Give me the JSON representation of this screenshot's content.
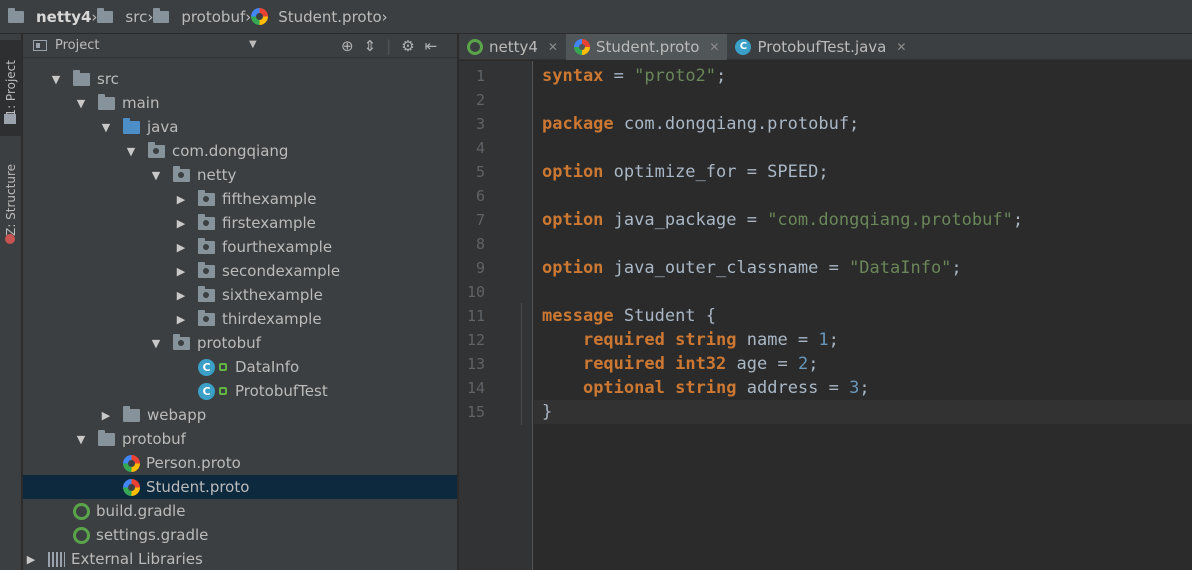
{
  "breadcrumb": {
    "items": [
      "netty4",
      "src",
      "protobuf",
      "Student.proto"
    ]
  },
  "tool_strip": {
    "project_tab": "1: Project",
    "structure_tab": "Z: Structure"
  },
  "project_panel": {
    "title": "Project",
    "tree": [
      {
        "label": "src",
        "kind": "folder",
        "expanded": true
      },
      {
        "label": "main",
        "kind": "folder",
        "expanded": true
      },
      {
        "label": "java",
        "kind": "source-folder",
        "expanded": true
      },
      {
        "label": "com.dongqiang",
        "kind": "package",
        "expanded": true
      },
      {
        "label": "netty",
        "kind": "package",
        "expanded": true
      },
      {
        "label": "fifthexample",
        "kind": "package",
        "expanded": false
      },
      {
        "label": "firstexample",
        "kind": "package",
        "expanded": false
      },
      {
        "label": "fourthexample",
        "kind": "package",
        "expanded": false
      },
      {
        "label": "secondexample",
        "kind": "package",
        "expanded": false
      },
      {
        "label": "sixthexample",
        "kind": "package",
        "expanded": false
      },
      {
        "label": "thirdexample",
        "kind": "package",
        "expanded": false
      },
      {
        "label": "protobuf",
        "kind": "package",
        "expanded": true
      },
      {
        "label": "DataInfo",
        "kind": "class"
      },
      {
        "label": "ProtobufTest",
        "kind": "class"
      },
      {
        "label": "webapp",
        "kind": "folder",
        "expanded": false
      },
      {
        "label": "protobuf",
        "kind": "folder",
        "expanded": true
      },
      {
        "label": "Person.proto",
        "kind": "proto"
      },
      {
        "label": "Student.proto",
        "kind": "proto",
        "selected": true
      },
      {
        "label": "build.gradle",
        "kind": "gradle"
      },
      {
        "label": "settings.gradle",
        "kind": "gradle"
      },
      {
        "label": "External Libraries",
        "kind": "libraries",
        "expanded": false
      }
    ]
  },
  "editor_tabs": [
    {
      "label": "netty4",
      "icon": "gradle-icon",
      "active": false
    },
    {
      "label": "Student.proto",
      "icon": "proto-icon",
      "active": true
    },
    {
      "label": "ProtobufTest.java",
      "icon": "class-icon",
      "active": false
    }
  ],
  "editor": {
    "line_numbers": [
      "1",
      "2",
      "3",
      "4",
      "5",
      "6",
      "7",
      "8",
      "9",
      "10",
      "11",
      "12",
      "13",
      "14",
      "15"
    ],
    "current_line": 15,
    "code_lines": [
      [
        {
          "t": "syntax",
          "c": "kw"
        },
        {
          "t": " = ",
          "c": ""
        },
        {
          "t": "\"proto2\"",
          "c": "str"
        },
        {
          "t": ";",
          "c": ""
        }
      ],
      [],
      [
        {
          "t": "package",
          "c": "kw"
        },
        {
          "t": " com.dongqiang.protobuf;",
          "c": ""
        }
      ],
      [],
      [
        {
          "t": "option",
          "c": "kw"
        },
        {
          "t": " optimize_for = SPEED;",
          "c": ""
        }
      ],
      [],
      [
        {
          "t": "option",
          "c": "kw"
        },
        {
          "t": " java_package = ",
          "c": ""
        },
        {
          "t": "\"com.dongqiang.protobuf\"",
          "c": "str"
        },
        {
          "t": ";",
          "c": ""
        }
      ],
      [],
      [
        {
          "t": "option",
          "c": "kw"
        },
        {
          "t": " java_outer_classname = ",
          "c": ""
        },
        {
          "t": "\"DataInfo\"",
          "c": "str"
        },
        {
          "t": ";",
          "c": ""
        }
      ],
      [],
      [
        {
          "t": "message",
          "c": "kw"
        },
        {
          "t": " Student {",
          "c": ""
        }
      ],
      [
        {
          "t": "    ",
          "c": ""
        },
        {
          "t": "required",
          "c": "kw"
        },
        {
          "t": " ",
          "c": ""
        },
        {
          "t": "string",
          "c": "kw"
        },
        {
          "t": " name = ",
          "c": ""
        },
        {
          "t": "1",
          "c": "num"
        },
        {
          "t": ";",
          "c": ""
        }
      ],
      [
        {
          "t": "    ",
          "c": ""
        },
        {
          "t": "required",
          "c": "kw"
        },
        {
          "t": " ",
          "c": ""
        },
        {
          "t": "int32",
          "c": "kw"
        },
        {
          "t": " age = ",
          "c": ""
        },
        {
          "t": "2",
          "c": "num"
        },
        {
          "t": ";",
          "c": ""
        }
      ],
      [
        {
          "t": "    ",
          "c": ""
        },
        {
          "t": "optional",
          "c": "kw"
        },
        {
          "t": " ",
          "c": ""
        },
        {
          "t": "string",
          "c": "kw"
        },
        {
          "t": " address = ",
          "c": ""
        },
        {
          "t": "3",
          "c": "num"
        },
        {
          "t": ";",
          "c": ""
        }
      ],
      [
        {
          "t": "}",
          "c": ""
        }
      ]
    ]
  }
}
